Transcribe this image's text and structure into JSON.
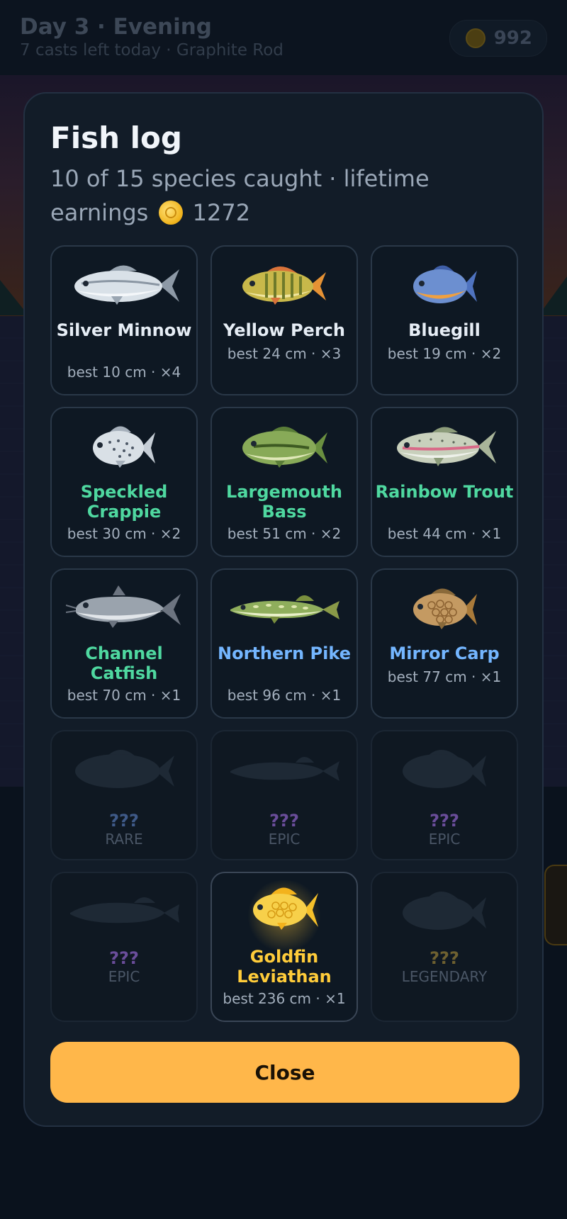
{
  "hud": {
    "title": "Day 3 · Evening",
    "subtitle": "7 casts left today · Graphite Rod",
    "coins": "992",
    "coin_icon": "coin-icon"
  },
  "modal": {
    "title": "Fish log",
    "subtitle_prefix": "10 of 15 species caught · lifetime earnings",
    "earnings": "1272",
    "close_label": "Close"
  },
  "colors": {
    "common": "#e6edf5",
    "uncommon": "#4fd8a0",
    "rare": "#74b6ff",
    "epic_locked": "#6a4d9a",
    "rare_locked": "#3f5a88",
    "legendary_locked": "#6e6030",
    "legendary": "#ffcc3a",
    "accent": "#ffb74a"
  },
  "fish": [
    {
      "name": "Silver Minnow",
      "best": "best 10 cm · ×4",
      "rarity": "common",
      "icon": "silver-minnow-icon"
    },
    {
      "name": "Yellow Perch",
      "best": "best 24 cm · ×3",
      "rarity": "common",
      "icon": "yellow-perch-icon"
    },
    {
      "name": "Bluegill",
      "best": "best 19 cm · ×2",
      "rarity": "common",
      "icon": "bluegill-icon"
    },
    {
      "name": "Speckled Crappie",
      "best": "best 30 cm · ×2",
      "rarity": "uncommon",
      "icon": "speckled-crappie-icon"
    },
    {
      "name": "Largemouth Bass",
      "best": "best 51 cm · ×2",
      "rarity": "uncommon",
      "icon": "largemouth-bass-icon"
    },
    {
      "name": "Rainbow Trout",
      "best": "best 44 cm · ×1",
      "rarity": "uncommon",
      "icon": "rainbow-trout-icon"
    },
    {
      "name": "Channel Catfish",
      "best": "best 70 cm · ×1",
      "rarity": "uncommon",
      "icon": "channel-catfish-icon"
    },
    {
      "name": "Northern Pike",
      "best": "best 96 cm · ×1",
      "rarity": "rare",
      "icon": "northern-pike-icon"
    },
    {
      "name": "Mirror Carp",
      "best": "best 77 cm · ×1",
      "rarity": "rare",
      "icon": "mirror-carp-icon"
    },
    {
      "name": "???",
      "tier": "RARE",
      "locked": true,
      "icon": "unknown-fish-silhouette-icon"
    },
    {
      "name": "???",
      "tier": "EPIC",
      "locked": true,
      "icon": "unknown-fish-silhouette-icon"
    },
    {
      "name": "???",
      "tier": "EPIC",
      "locked": true,
      "icon": "unknown-fish-silhouette-icon"
    },
    {
      "name": "???",
      "tier": "EPIC",
      "locked": true,
      "icon": "unknown-fish-silhouette-icon"
    },
    {
      "name": "Goldfin Leviathan",
      "best": "best 236 cm · ×1",
      "rarity": "legendary",
      "icon": "goldfin-leviathan-icon"
    },
    {
      "name": "???",
      "tier": "LEGENDARY",
      "locked": true,
      "icon": "unknown-fish-silhouette-icon"
    }
  ]
}
